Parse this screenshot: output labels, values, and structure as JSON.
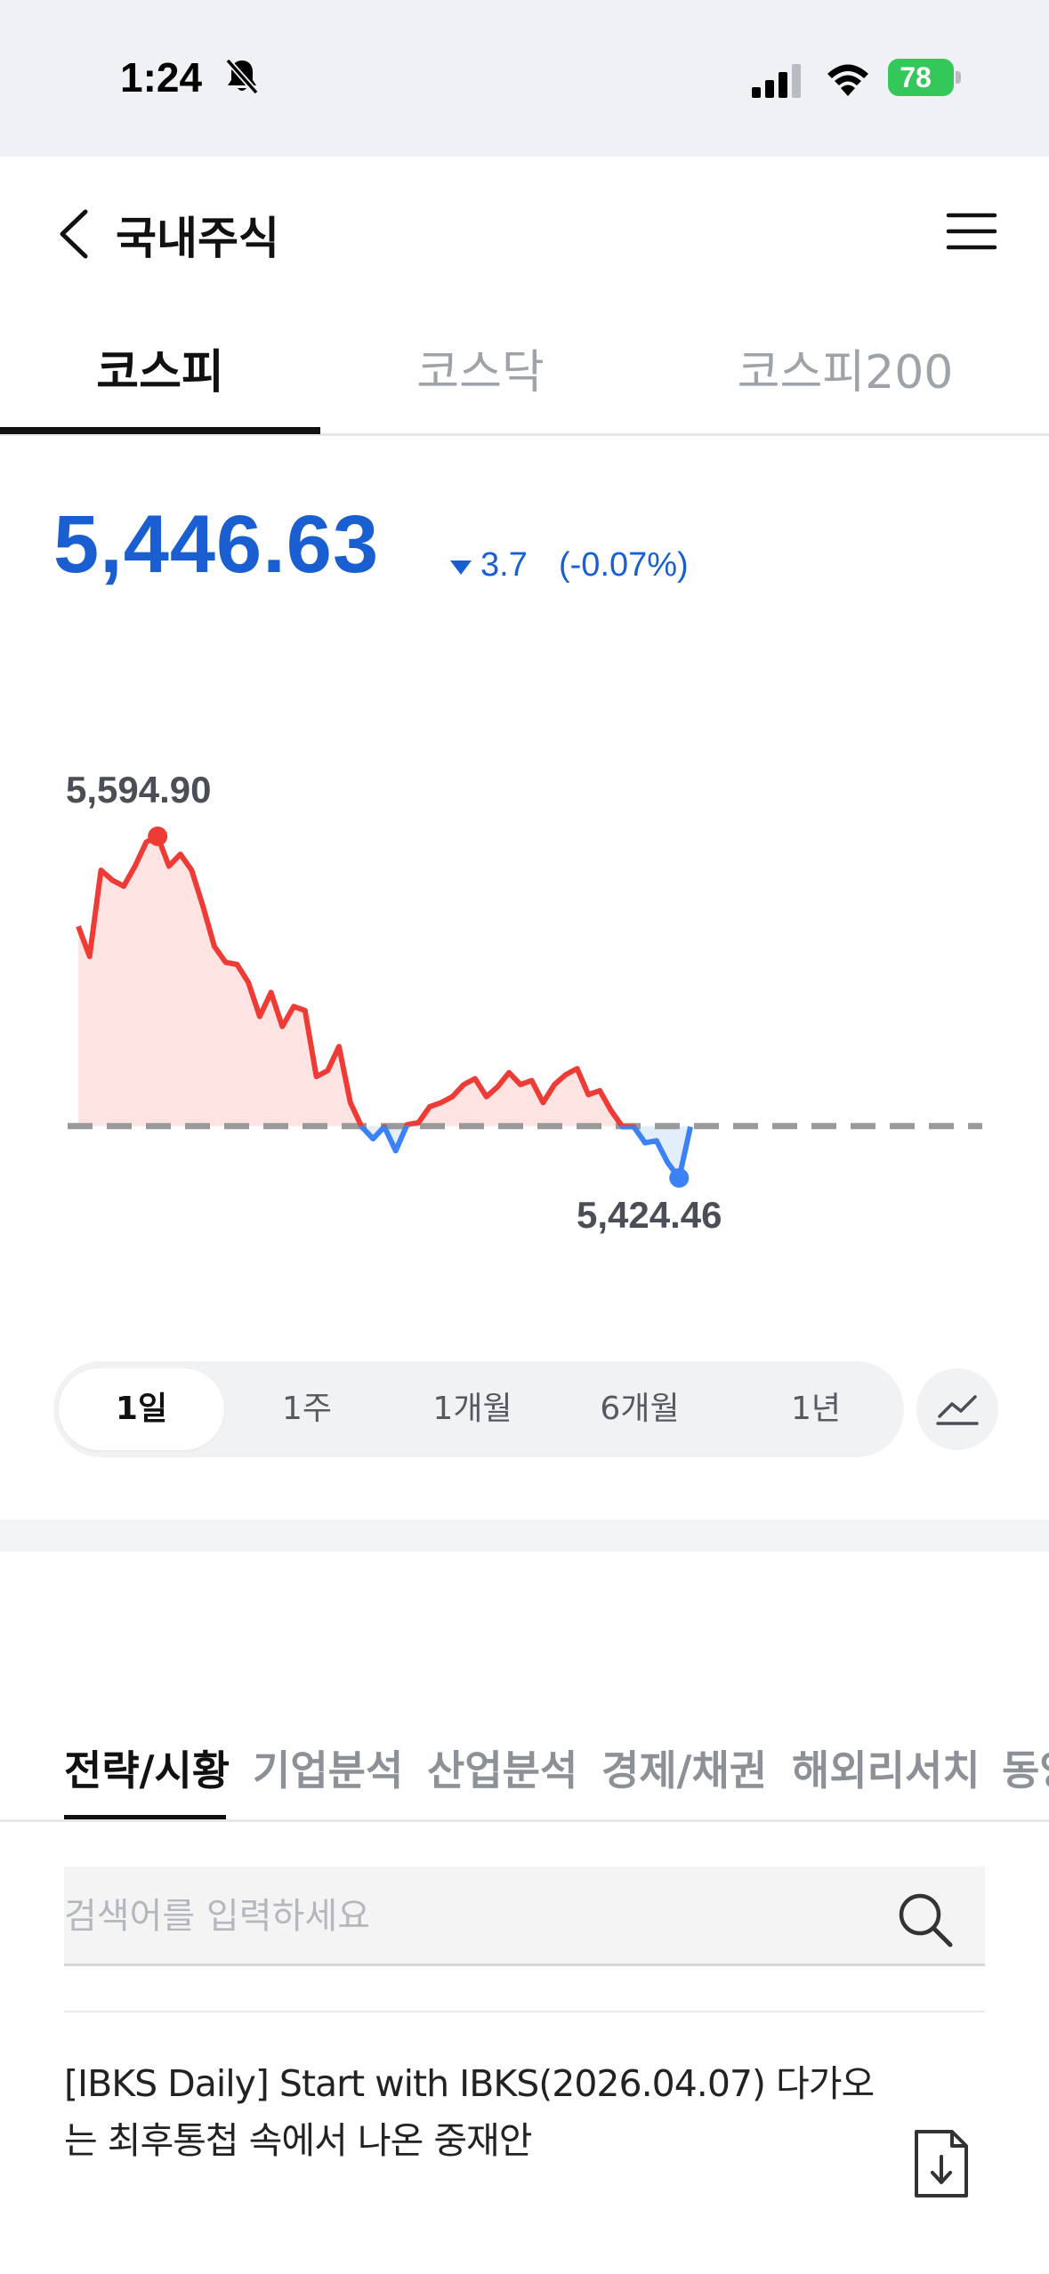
{
  "status_bar": {
    "time": "1:24",
    "battery": "78"
  },
  "header": {
    "title": "국내주식"
  },
  "index_tabs": [
    {
      "label": "코스피",
      "active": true
    },
    {
      "label": "코스닥",
      "active": false
    },
    {
      "label": "코스피200",
      "active": false
    }
  ],
  "quote": {
    "price": "5,446.63",
    "change": "3.7",
    "change_pct": "(-0.07%)",
    "direction": "down"
  },
  "chart_data": {
    "type": "line",
    "period": "1일",
    "high_label": "5,594.90",
    "low_label": "5,424.46",
    "baseline": 5450.3,
    "values": [
      5550,
      5535,
      5578,
      5573,
      5570,
      5580,
      5592,
      5594.9,
      5580,
      5586,
      5578,
      5560,
      5540,
      5532,
      5531,
      5522,
      5505,
      5517,
      5500,
      5510,
      5508,
      5475,
      5478,
      5490,
      5462,
      5450,
      5444,
      5450,
      5438,
      5451,
      5452,
      5460,
      5462,
      5465,
      5471,
      5474,
      5465,
      5470,
      5477,
      5471,
      5473,
      5462,
      5471,
      5476,
      5479,
      5466,
      5468,
      5458,
      5450,
      5450,
      5442,
      5443,
      5432,
      5424.46,
      5450
    ],
    "colors": {
      "up": "#ef3b35",
      "down": "#3b82f6",
      "baseline": "#9a9a9a",
      "label": "#4a4f57"
    }
  },
  "periods": [
    {
      "label": "1일",
      "active": true
    },
    {
      "label": "1주",
      "active": false
    },
    {
      "label": "1개월",
      "active": false
    },
    {
      "label": "6개월",
      "active": false
    },
    {
      "label": "1년",
      "active": false
    }
  ],
  "research_tabs": [
    {
      "label": "전략/시황",
      "active": true
    },
    {
      "label": "기업분석",
      "active": false
    },
    {
      "label": "산업분석",
      "active": false
    },
    {
      "label": "경제/채권",
      "active": false
    },
    {
      "label": "해외리서치",
      "active": false
    },
    {
      "label": "동양",
      "active": false
    }
  ],
  "search": {
    "placeholder": "검색어를 입력하세요"
  },
  "reports": [
    {
      "title": "[IBKS Daily] Start with IBKS(2026.04.07) 다가오는 최후통첩 속에서 나온 중재안"
    }
  ]
}
